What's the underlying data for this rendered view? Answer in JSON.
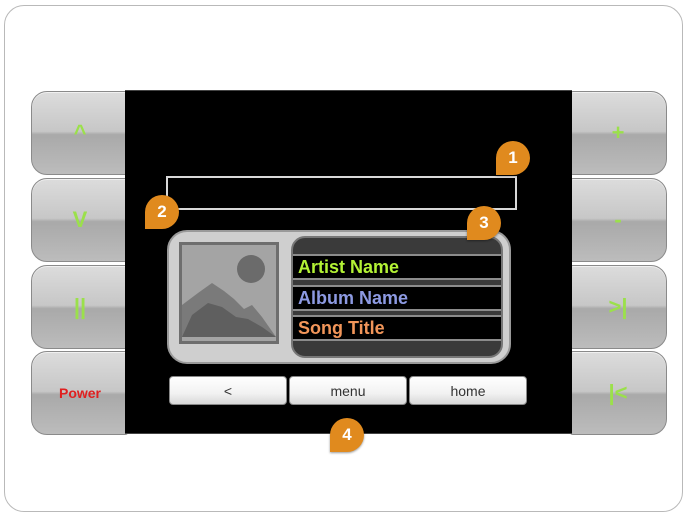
{
  "side_buttons": {
    "left": [
      "^",
      "V",
      "||",
      "Power"
    ],
    "right": [
      "+",
      "-",
      ">|",
      "|<"
    ]
  },
  "track": {
    "artist": "Artist Name",
    "album": "Album Name",
    "song": "Song Title"
  },
  "nav": {
    "back_label": "<",
    "menu_label": "menu",
    "home_label": "home"
  },
  "callouts": [
    "1",
    "2",
    "3",
    "4"
  ],
  "colors": {
    "button_glyph": "#9be04b",
    "power": "#e02020",
    "artist": "#b3f235",
    "album": "#8d9ae2",
    "song": "#f2965a",
    "callout": "#e08a1e"
  }
}
